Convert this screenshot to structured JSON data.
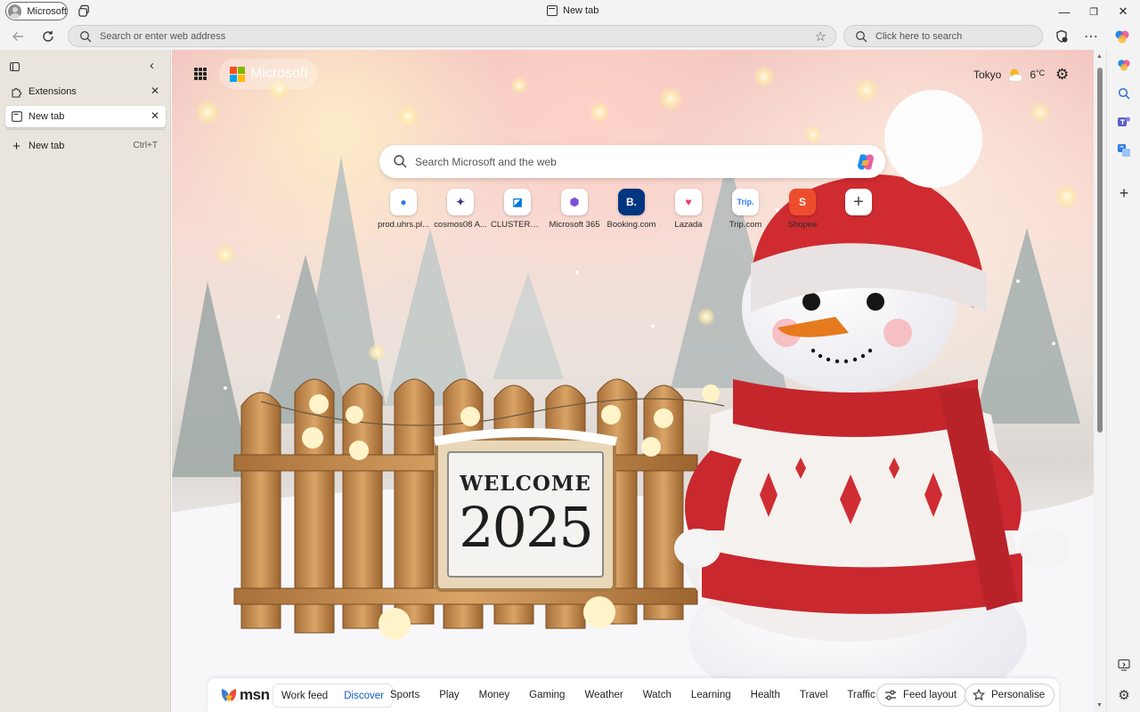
{
  "window": {
    "profile_name": "Microsoft",
    "tab_title": "New tab",
    "minimize": "—",
    "restore": "❐",
    "close": "✕"
  },
  "toolbar": {
    "address_placeholder": "Search or enter web address",
    "search_placeholder": "Click here to search"
  },
  "sidebar": {
    "items": [
      {
        "label": "Extensions"
      },
      {
        "label": "New tab"
      }
    ],
    "new_tab": {
      "label": "New tab",
      "shortcut": "Ctrl+T"
    }
  },
  "newtab": {
    "brand": "Microsoft",
    "weather": {
      "city": "Tokyo",
      "temp": "6",
      "unit": "°C"
    },
    "search_placeholder": "Search Microsoft and the web",
    "quick_links": [
      {
        "label": "prod.uhrs.pl...",
        "icon": "uhrs-icon",
        "glyph": "●",
        "color": "#2f7be8"
      },
      {
        "label": "cosmos08 A...",
        "icon": "cosmos-icon",
        "glyph": "✦",
        "color": "#3b3b8f"
      },
      {
        "label": "CLUSTERED ...",
        "icon": "azure-devops-icon",
        "glyph": "◪",
        "color": "#0078d4"
      },
      {
        "label": "Microsoft 365",
        "icon": "m365-icon",
        "glyph": "⬢",
        "color": "#7b4fd6"
      },
      {
        "label": "Booking.com",
        "icon": "booking-icon",
        "glyph": "B.",
        "color": "#ffffff"
      },
      {
        "label": "Lazada",
        "icon": "lazada-icon",
        "glyph": "♥",
        "color": "#f0386b"
      },
      {
        "label": "Trip.com",
        "icon": "trip-icon",
        "glyph": "Trip.",
        "color": "#287dfa"
      },
      {
        "label": "Shopee",
        "icon": "shopee-icon",
        "glyph": "S",
        "color": "#ffffff"
      }
    ],
    "add_shortcut_label": "+",
    "sign_text": {
      "line1": "WELCOME",
      "line2": "2025"
    }
  },
  "msn": {
    "brand": "msn",
    "feed_tabs": [
      {
        "label": "Work feed",
        "active": false
      },
      {
        "label": "Discover",
        "active": true
      }
    ],
    "categories": [
      "Sports",
      "Play",
      "Money",
      "Gaming",
      "Weather",
      "Watch",
      "Learning",
      "Health",
      "Travel",
      "Traffic"
    ],
    "feed_layout_label": "Feed layout",
    "personalise_label": "Personalise"
  }
}
